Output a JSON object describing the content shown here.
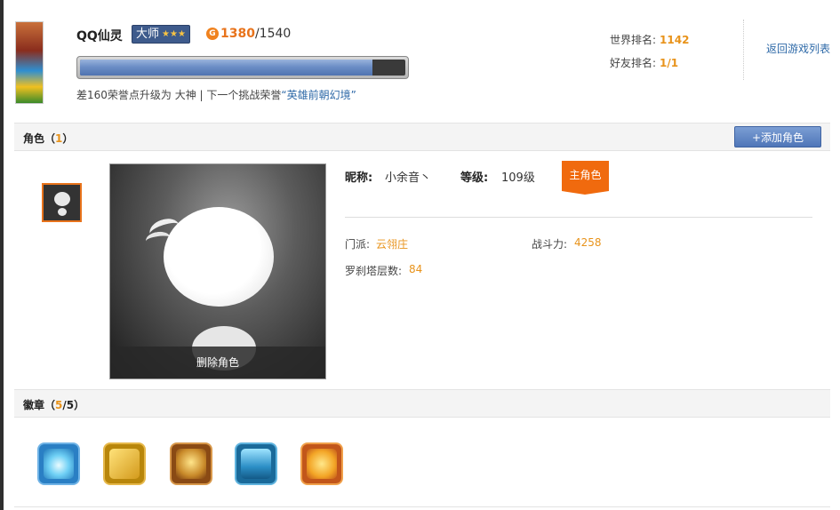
{
  "game": {
    "title": "QQ仙灵",
    "rank_name": "大师",
    "rank_stars": "★★★",
    "honor_current": "1380",
    "honor_max": "/1540",
    "progress_fraction": 0.9,
    "tip_prefix": "差160荣誉点升级为 大神 | 下一个挑战荣誉",
    "tip_highlight": "“英雄前朝幻境”"
  },
  "ranks": {
    "world_label": "世界排名:",
    "world_value": "1142",
    "friend_label": "好友排名:",
    "friend_value": "1/1"
  },
  "back_link": "返回游戏列表",
  "roles_section": {
    "title": "角色（",
    "count": "1",
    "close": "）",
    "add_button": "+添加角色"
  },
  "role": {
    "delete_label": "删除角色",
    "nick_label": "昵称:",
    "nick_value": "小余音丶",
    "level_label": "等级:",
    "level_value": "109级",
    "main_badge": "主角色",
    "school_label": "门派:",
    "school_value": "云翎庄",
    "power_label": "战斗力:",
    "power_value": "4258",
    "tower_label": "罗刹塔层数:",
    "tower_value": "84"
  },
  "badges_section": {
    "title": "徽章（",
    "count": "5",
    "total": "/5）"
  },
  "badges": [
    "badge-1",
    "badge-2",
    "badge-3",
    "badge-4",
    "badge-5"
  ],
  "colors": {
    "accent_orange": "#e8931b",
    "link_blue": "#2f6aa8",
    "button_blue": "#4f76b8",
    "main_badge": "#f06a0e"
  }
}
